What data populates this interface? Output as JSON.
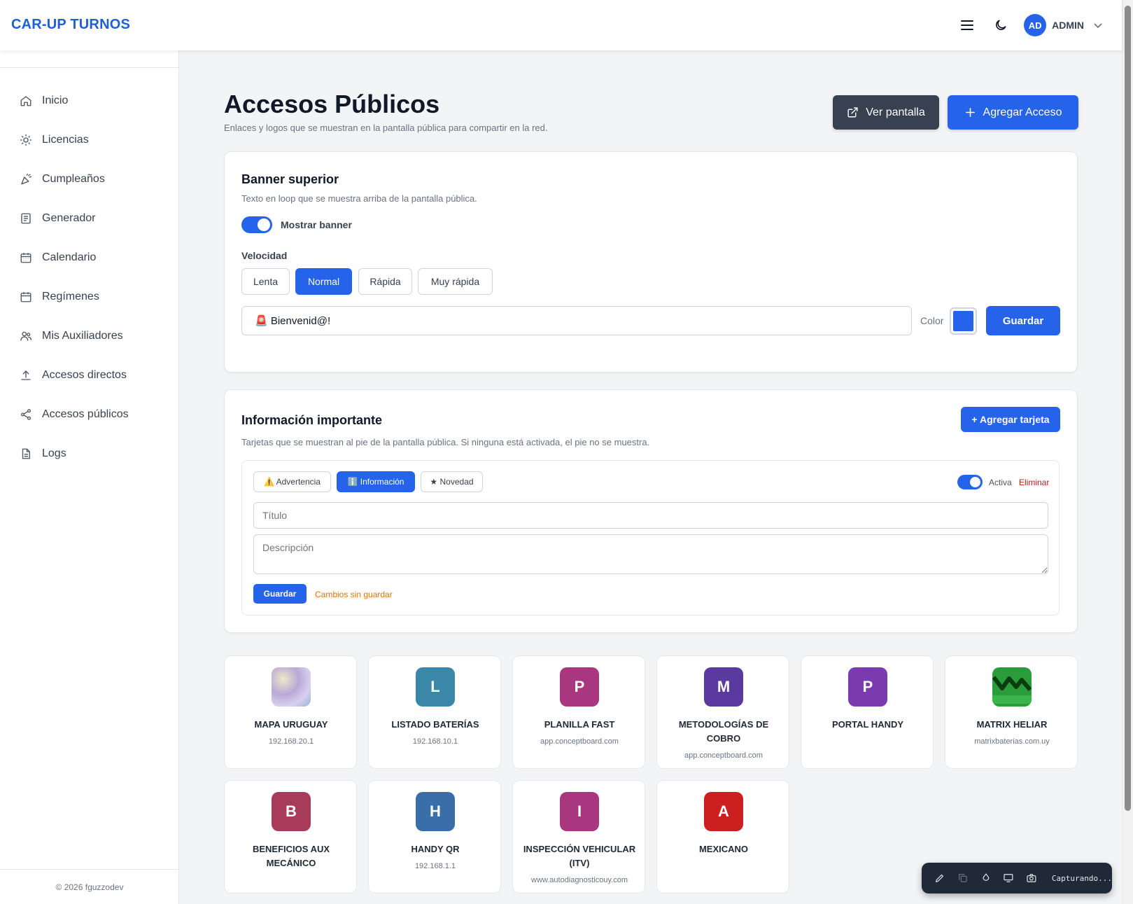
{
  "app": {
    "brand": "CAR-UP TURNOS"
  },
  "header": {
    "avatar_initials": "AD",
    "user_name": "ADMIN"
  },
  "sidebar": {
    "items": [
      {
        "label": "Inicio",
        "icon": "home-icon"
      },
      {
        "label": "Licencias",
        "icon": "sun-icon"
      },
      {
        "label": "Cumpleaños",
        "icon": "party-icon"
      },
      {
        "label": "Generador",
        "icon": "file-grid-icon"
      },
      {
        "label": "Calendario",
        "icon": "calendar-grid-icon"
      },
      {
        "label": "Regímenes",
        "icon": "calendar-icon"
      },
      {
        "label": "Mis Auxiliadores",
        "icon": "users-icon"
      },
      {
        "label": "Accesos directos",
        "icon": "upload-icon"
      },
      {
        "label": "Accesos públicos",
        "icon": "share-icon"
      },
      {
        "label": "Logs",
        "icon": "document-icon"
      }
    ],
    "footer": "© 2026 fguzzodev"
  },
  "page": {
    "title": "Accesos Públicos",
    "subtitle": "Enlaces y logos que se muestran en la pantalla pública para compartir en la red.",
    "view_screen_label": "Ver pantalla",
    "add_access_label": "Agregar Acceso"
  },
  "banner": {
    "title": "Banner superior",
    "subtitle": "Texto en loop que se muestra arriba de la pantalla pública.",
    "toggle_label": "Mostrar banner",
    "speed_label": "Velocidad",
    "speeds": [
      "Lenta",
      "Normal",
      "Rápida",
      "Muy rápida"
    ],
    "selected_speed": "Normal",
    "text_value": "🚨 Bienvenid@!",
    "color_label": "Color",
    "color_value": "#2563eb",
    "save_label": "Guardar"
  },
  "info": {
    "title": "Información importante",
    "subtitle": "Tarjetas que se muestran al pie de la pantalla pública. Si ninguna está activada, el pie no se muestra.",
    "add_card_label": "+ Agregar tarjeta",
    "types": [
      "⚠️ Advertencia",
      "ℹ️ Información",
      "★ Novedad"
    ],
    "selected_type": "Información",
    "active_label": "Activa",
    "delete_label": "Eliminar",
    "title_placeholder": "Título",
    "description_placeholder": "Descripción",
    "save_label": "Guardar",
    "unsaved_label": "Cambios sin guardar"
  },
  "links": [
    {
      "letter": "",
      "name": "MAPA URUGUAY",
      "url": "192.168.20.1",
      "color": "#c9c3e3"
    },
    {
      "letter": "L",
      "name": "LISTADO BATERÍAS",
      "url": "192.168.10.1",
      "color": "#3a87a8"
    },
    {
      "letter": "P",
      "name": "PLANILLA FAST",
      "url": "app.conceptboard.com",
      "color": "#a8377f"
    },
    {
      "letter": "M",
      "name": "METODOLOGÍAS DE COBRO",
      "url": "app.conceptboard.com",
      "color": "#5b3aa0"
    },
    {
      "letter": "P",
      "name": "PORTAL HANDY",
      "url": "",
      "color": "#7a3ab0"
    },
    {
      "letter": "",
      "name": "MATRIX HELIAR",
      "url": "matrixbaterias.com.uy",
      "color": "#2a9d3a"
    },
    {
      "letter": "B",
      "name": "BENEFICIOS AUX MECÁNICO",
      "url": "",
      "color": "#a83a5a"
    },
    {
      "letter": "H",
      "name": "HANDY QR",
      "url": "192.168.1.1",
      "color": "#3a6ea8"
    },
    {
      "letter": "I",
      "name": "INSPECCIÓN VEHICULAR (ITV)",
      "url": "www.autodiagnosticouy.com",
      "color": "#a8377f"
    },
    {
      "letter": "A",
      "name": "MEXICANO",
      "url": "",
      "color": "#cc1f1f"
    }
  ],
  "capture": {
    "label": "Capturando..."
  }
}
